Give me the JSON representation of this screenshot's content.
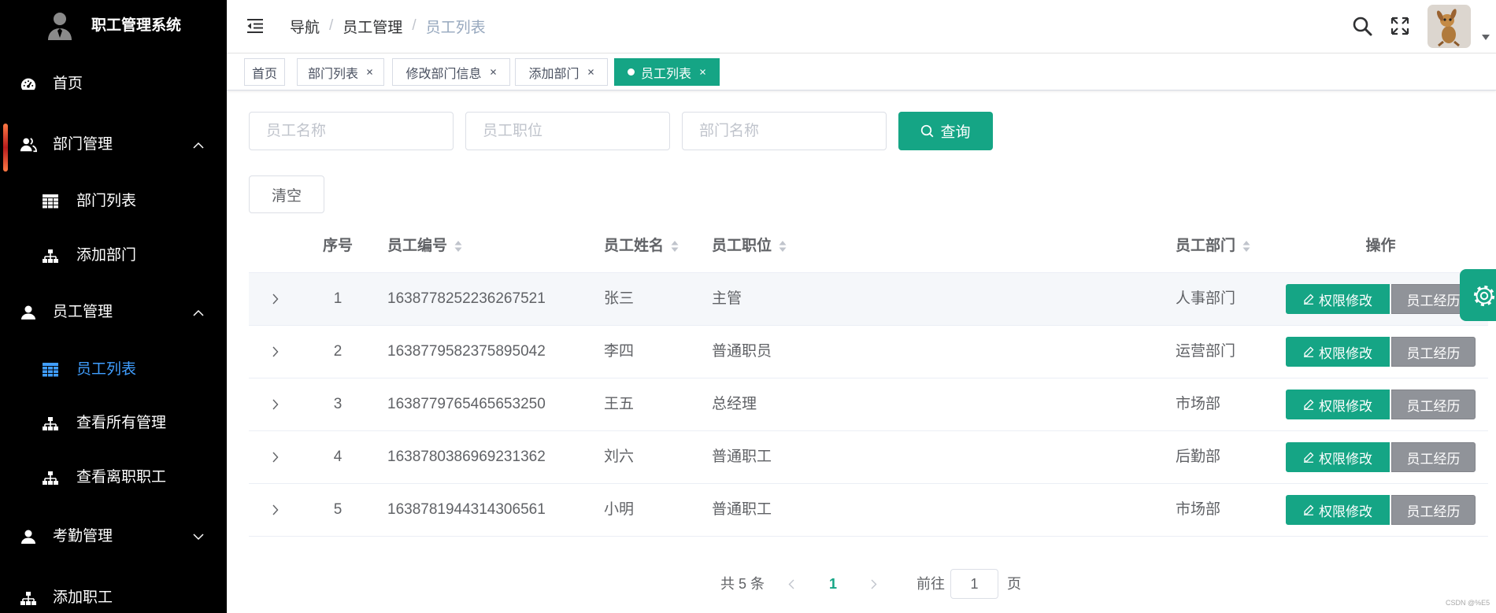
{
  "app": {
    "title": "职工管理系统"
  },
  "sidebar": {
    "items": [
      {
        "label": "首页",
        "icon": "dashboard-icon"
      },
      {
        "label": "部门管理",
        "icon": "user-group-icon",
        "expanded": true
      },
      {
        "label": "部门列表",
        "icon": "table-icon"
      },
      {
        "label": "添加部门",
        "icon": "sitemap-icon"
      },
      {
        "label": "员工管理",
        "icon": "user-icon",
        "expanded": true
      },
      {
        "label": "员工列表",
        "icon": "table-icon",
        "active": true
      },
      {
        "label": "查看所有管理",
        "icon": "sitemap-icon"
      },
      {
        "label": "查看离职职工",
        "icon": "sitemap-icon"
      },
      {
        "label": "考勤管理",
        "icon": "user-icon",
        "expanded": false
      },
      {
        "label": "添加职工",
        "icon": "sitemap-icon"
      }
    ]
  },
  "header": {
    "icons": {
      "toggle": "menu-fold-icon",
      "search": "search-icon",
      "fullscreen": "fullscreen-icon",
      "avatar": "avatar"
    },
    "breadcrumb": {
      "items": [
        "导航",
        "员工管理",
        "员工列表"
      ],
      "separator": "/"
    }
  },
  "tabs": [
    {
      "label": "首页",
      "closable": false
    },
    {
      "label": "部门列表",
      "closable": true
    },
    {
      "label": "修改部门信息",
      "closable": true
    },
    {
      "label": "添加部门",
      "closable": true
    },
    {
      "label": "员工列表",
      "closable": true,
      "active": true
    }
  ],
  "search": {
    "name_placeholder": "员工名称",
    "position_placeholder": "员工职位",
    "department_placeholder": "部门名称",
    "query_label": "查询",
    "clear_label": "清空"
  },
  "table": {
    "headers": {
      "index": "序号",
      "id": "员工编号",
      "name": "员工姓名",
      "position": "员工职位",
      "department": "员工部门",
      "actions": "操作"
    },
    "rows": [
      {
        "index": "1",
        "id": "1638778252236267521",
        "name": "张三",
        "position": "主管",
        "department": "人事部门"
      },
      {
        "index": "2",
        "id": "1638779582375895042",
        "name": "李四",
        "position": "普通职员",
        "department": "运营部门"
      },
      {
        "index": "3",
        "id": "1638779765465653250",
        "name": "王五",
        "position": "总经理",
        "department": "市场部"
      },
      {
        "index": "4",
        "id": "1638780386969231362",
        "name": "刘六",
        "position": "普通职工",
        "department": "后勤部"
      },
      {
        "index": "5",
        "id": "1638781944314306561",
        "name": "小明",
        "position": "普通职工",
        "department": "市场部"
      }
    ]
  },
  "row_actions": {
    "edit_label": "权限修改",
    "history_label": "员工经历"
  },
  "settings_button": {
    "icon": "gear-icon"
  },
  "pagination": {
    "total_text": "共 5 条",
    "current_page": "1",
    "goto_label": "前往",
    "goto_value": "1",
    "page_suffix": "页"
  },
  "watermark": "CSDN @%E5",
  "colors": {
    "sidebar_bg": "#000000",
    "accent_green": "#15a585",
    "active_menu": "#409eff",
    "muted_button": "#909399"
  }
}
